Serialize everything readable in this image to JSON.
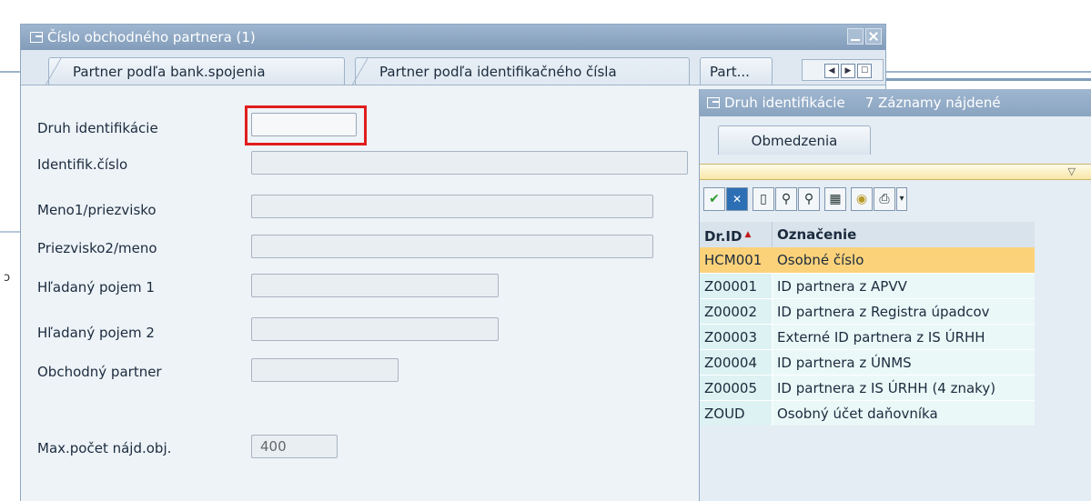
{
  "dialog": {
    "title": "Číslo obchodného partnera (1)",
    "tabs": [
      {
        "label": "Partner podľa bank.spojenia"
      },
      {
        "label": "Partner podľa identifikačného čísla"
      },
      {
        "label": "Part..."
      }
    ]
  },
  "form": {
    "fields": [
      {
        "label": "Druh identifikácie",
        "value": ""
      },
      {
        "label": "Identifik.číslo",
        "value": ""
      },
      {
        "label": "Meno1/priezvisko",
        "value": ""
      },
      {
        "label": "Priezvisko2/meno",
        "value": ""
      },
      {
        "label": "Hľadaný pojem 1",
        "value": ""
      },
      {
        "label": "Hľadaný pojem 2",
        "value": ""
      },
      {
        "label": "Obchodný partner",
        "value": ""
      },
      {
        "label": "Max.počet nájd.obj.",
        "value": "400"
      }
    ]
  },
  "popup": {
    "title": "Druh identifikácie",
    "count": "7 Záznamy nájdené",
    "tab": "Obmedzenia",
    "columns": {
      "id": "Dr.ID",
      "name": "Označenie"
    },
    "rows": [
      {
        "id": "HCM001",
        "name": "Osobné číslo",
        "selected": true
      },
      {
        "id": "Z00001",
        "name": "ID partnera z APVV"
      },
      {
        "id": "Z00002",
        "name": "ID partnera z Registra úpadcov"
      },
      {
        "id": "Z00003",
        "name": "Externé ID partnera z IS ÚRHH"
      },
      {
        "id": "Z00004",
        "name": "ID partnera z ÚNMS"
      },
      {
        "id": "Z00005",
        "name": "ID partnera z IS ÚRHH (4 znaky)"
      },
      {
        "id": "ZOUD",
        "name": "Osobný účet daňovníka"
      }
    ]
  },
  "colors": {
    "highlight": "#e01d1d",
    "selected_row": "#fbd27a",
    "titlebar": "#819cba"
  }
}
